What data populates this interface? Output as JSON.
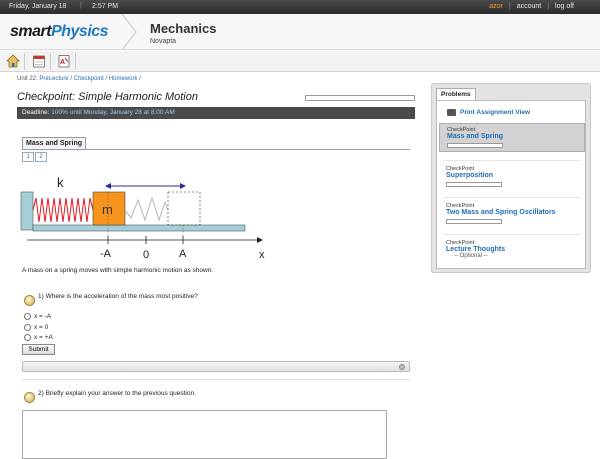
{
  "topbar": {
    "date": "Friday, January 18",
    "time": "2:57 PM",
    "user": "azor",
    "account": "account",
    "logout": "log off"
  },
  "header": {
    "logo_part1": "smart",
    "logo_part2": "Physics",
    "course": "Mechanics",
    "institution": "Novapta"
  },
  "toolbar": {
    "icons": [
      "home-icon",
      "calendar-icon",
      "gradebook-icon"
    ]
  },
  "breadcrumb": {
    "unit": "Unit 22:",
    "items": [
      "PreLecture",
      "Checkpoint",
      "Homework"
    ]
  },
  "page": {
    "title": "Checkpoint: Simple Harmonic Motion",
    "deadline_label": "Deadline:",
    "deadline_value": "100% until Monday, January 28 at 8:00 AM"
  },
  "section": {
    "tab": "Mass and Spring",
    "pages": [
      "1",
      "2"
    ]
  },
  "diagram": {
    "k": "k",
    "m": "m",
    "minus_a": "-A",
    "zero": "0",
    "a": "A",
    "x": "x",
    "colors": {
      "mass": "#f7941d",
      "spring": "#e0191e",
      "arrow": "#2b2b9c",
      "rail": "#a5cfd6"
    }
  },
  "question1": {
    "intro": "A mass on a spring moves with simple harmonic motion as shown.",
    "text": "1) Where is the acceleration of the mass most positive?",
    "options": [
      "x = -A",
      "x = 0",
      "x = +A"
    ],
    "submit": "Submit"
  },
  "question2": {
    "text": "2) Briefly explain your answer to the previous question."
  },
  "sidebar": {
    "tab": "Problems",
    "print": "Print Assignment View",
    "items": [
      {
        "kind": "CheckPoint",
        "name": "Mass and Spring",
        "note": ""
      },
      {
        "kind": "CheckPoint",
        "name": "Superposition",
        "note": ""
      },
      {
        "kind": "CheckPoint",
        "name": "Two Mass and Spring Oscillators",
        "note": ""
      },
      {
        "kind": "CheckPoint",
        "name": "Lecture Thoughts",
        "note": "-- Optional --"
      }
    ]
  }
}
